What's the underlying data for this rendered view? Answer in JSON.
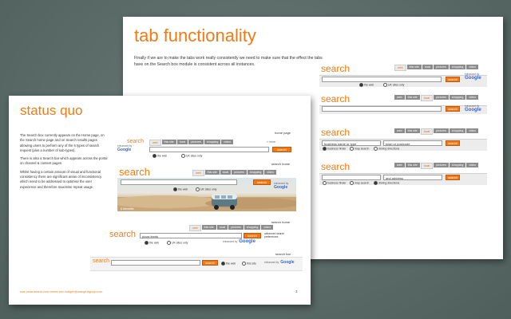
{
  "back_slide": {
    "title": "tab functionality",
    "paragraph": "Finally if we are to make the tabs work really consistently we need to make sure that the effect the tabs have on the Search box module is consistent across all instances.",
    "tabs": [
      "web",
      "this site",
      "local",
      "pictures",
      "shopping",
      "video"
    ],
    "search_label": "search",
    "search_button": "search",
    "enhanced_by": "enhanced by",
    "google": "Google",
    "radio_web": "the web",
    "radio_uk": "UK sites only",
    "local_business": "business name or type",
    "local_town": "town or postcode",
    "radio_business_finder": "business finder",
    "radio_map_search": "map search",
    "radio_driving": "driving directions",
    "field_value_last": "and address"
  },
  "front_slide": {
    "title": "status quo",
    "paragraphs": [
      "The Search box currently appears on the Home page, on the Search home page and on Search results pages allowing users to perform any of the 6 types of search request (plus a number of sub-types).",
      "There is also a Search bar which appears across the portal on channel & content pages.",
      "Whilst having a certain amount of visual and functional consistency there are significant areas of inconsistency which need to be addressed to optimise the user experience and therefore maximise repeat usage."
    ],
    "label_home_page": "home page",
    "label_search_home": "search home",
    "label_search_home_2": "search home",
    "label_search_bar": "search bar",
    "more": "» more",
    "search_label": "search",
    "search_button": "search",
    "tabs": [
      "web",
      "this site",
      "local",
      "pictures",
      "shopping",
      "video"
    ],
    "radio_web": "the web",
    "radio_uk": "UK sites only",
    "radio_this_site": "this site",
    "enhanced_by": "enhanced by",
    "google": "Google",
    "pizza_value": "pizza leeds",
    "advanced_link": "advanced search preferences",
    "photo_caption": "& thereafter",
    "footer": "nwe portal search tone review   tom.mctigen@orange-ftgroup.com",
    "page_number": "3"
  }
}
